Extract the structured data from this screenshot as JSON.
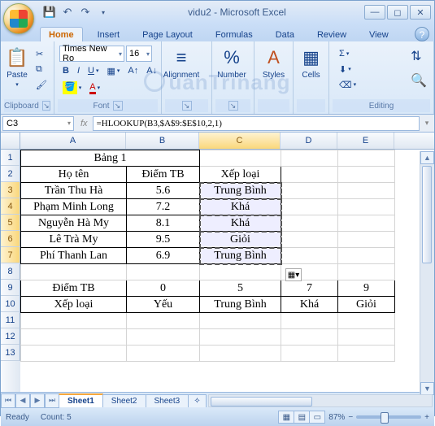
{
  "window": {
    "title": "vidu2 - Microsoft Excel"
  },
  "tabs": {
    "home": "Home",
    "insert": "Insert",
    "pagelayout": "Page Layout",
    "formulas": "Formulas",
    "data": "Data",
    "review": "Review",
    "view": "View"
  },
  "ribbon": {
    "clipboard": {
      "label": "Clipboard",
      "paste": "Paste"
    },
    "font": {
      "label": "Font",
      "name": "Times New Ro",
      "size": "16"
    },
    "alignment": {
      "label": "Alignment"
    },
    "number": {
      "label": "Number",
      "pct": "%"
    },
    "styles": {
      "label": "Styles"
    },
    "cells": {
      "label": "Cells"
    },
    "editing": {
      "label": "Editing",
      "sigma": "Σ"
    }
  },
  "fbar": {
    "namebox": "C3",
    "formula": "=HLOOKUP(B3,$A$9:$E$10,2,1)"
  },
  "cols": {
    "A": "A",
    "B": "B",
    "C": "C",
    "D": "D",
    "E": "E"
  },
  "colwidths": {
    "A": 130,
    "B": 90,
    "C": 100,
    "D": 70,
    "E": 70
  },
  "sheet": {
    "title": "Bảng 1",
    "h_a": "Họ tên",
    "h_b": "Điểm TB",
    "h_c": "Xếp loại",
    "rows": [
      {
        "a": "Trần Thu Hà",
        "b": "5.6",
        "c": "Trung Bình"
      },
      {
        "a": "Phạm Minh Long",
        "b": "7.2",
        "c": "Khá"
      },
      {
        "a": "Nguyễn Hà My",
        "b": "8.1",
        "c": "Khá"
      },
      {
        "a": "Lê Trà My",
        "b": "9.5",
        "c": "Giỏi"
      },
      {
        "a": "Phí Thanh Lan",
        "b": "6.9",
        "c": "Trung Bình"
      }
    ],
    "lk_h": "Điểm TB",
    "lk_b0": "0",
    "lk_b1": "5",
    "lk_b2": "7",
    "lk_b3": "9",
    "lk_h2": "Xếp loại",
    "lk_c0": "Yếu",
    "lk_c1": "Trung Bình",
    "lk_c2": "Khá",
    "lk_c3": "Giỏi"
  },
  "sheettabs": {
    "s1": "Sheet1",
    "s2": "Sheet2",
    "s3": "Sheet3"
  },
  "status": {
    "ready": "Ready",
    "count": "Count: 5",
    "zoom": "87%"
  },
  "watermark": "uanTrinang"
}
